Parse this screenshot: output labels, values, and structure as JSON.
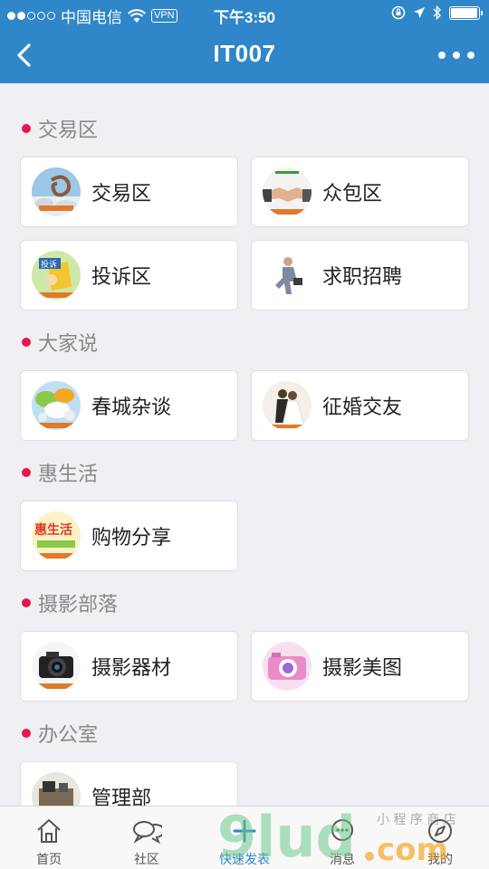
{
  "status_bar": {
    "carrier": "中国电信",
    "vpn": "VPN",
    "time": "下午3:50",
    "battery_level": 0.95
  },
  "nav": {
    "title": "IT007",
    "back_icon": "chevron-left-icon",
    "more_icon": "more-horizontal-icon"
  },
  "sections": [
    {
      "title": "交易区",
      "items": [
        {
          "label": "交易区",
          "icon": "trade-thumbnail"
        },
        {
          "label": "众包区",
          "icon": "handshake-thumbnail"
        },
        {
          "label": "投诉区",
          "icon": "complaint-thumbnail"
        },
        {
          "label": "求职招聘",
          "icon": "jobseeker-thumbnail"
        }
      ]
    },
    {
      "title": "大家说",
      "items": [
        {
          "label": "春城杂谈",
          "icon": "chat-bubbles-thumbnail"
        },
        {
          "label": "征婚交友",
          "icon": "wedding-couple-thumbnail"
        }
      ]
    },
    {
      "title": "惠生活",
      "items": [
        {
          "label": "购物分享",
          "icon": "hui-life-thumbnail",
          "thumb_text": "惠生活"
        }
      ]
    },
    {
      "title": "摄影部落",
      "items": [
        {
          "label": "摄影器材",
          "icon": "camera-thumbnail"
        },
        {
          "label": "摄影美图",
          "icon": "pink-camera-thumbnail"
        }
      ]
    },
    {
      "title": "办公室",
      "items": [
        {
          "label": "管理部",
          "icon": "office-thumbnail"
        }
      ]
    }
  ],
  "tabbar": [
    {
      "label": "首页",
      "icon": "home-icon"
    },
    {
      "label": "社区",
      "icon": "chat-icon"
    },
    {
      "label": "快速发表",
      "icon": "plus-icon"
    },
    {
      "label": "消息",
      "icon": "message-icon"
    },
    {
      "label": "我的",
      "icon": "compass-icon"
    }
  ],
  "colors": {
    "accent": "#2f86c9",
    "section_dot": "#e8164a",
    "background": "#efeff4"
  }
}
